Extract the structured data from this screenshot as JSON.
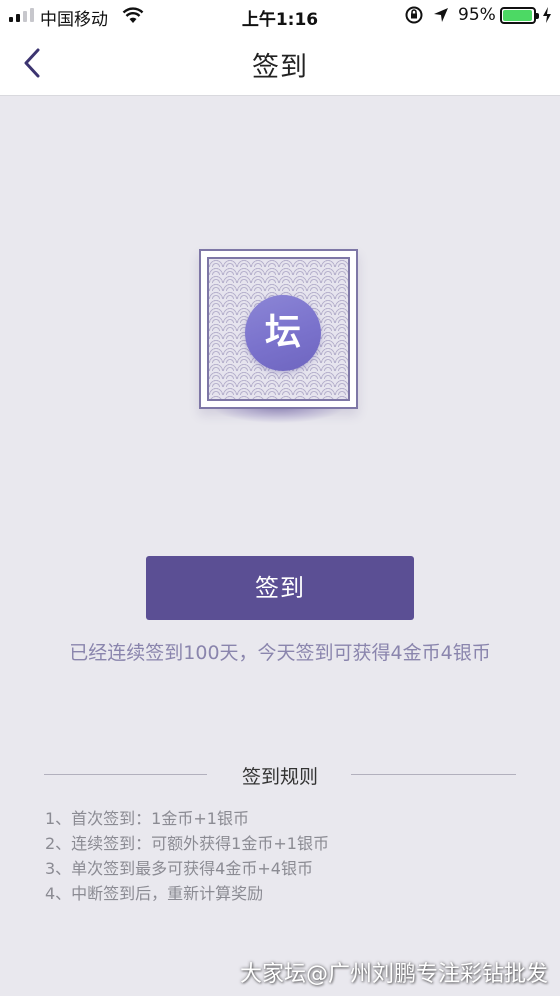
{
  "status_bar": {
    "carrier": "中国移动",
    "time": "上午1:16",
    "battery_pct": "95%",
    "battery_level": 0.95,
    "battery_color": "#4cd964"
  },
  "nav": {
    "title": "签到",
    "back_icon": "chevron-left-icon"
  },
  "badge": {
    "logo_text": "坛"
  },
  "sign_button": {
    "label": "签到",
    "color": "#5b4f94"
  },
  "status_text": "已经连续签到100天，今天签到可获得4金币4银币",
  "rules": {
    "title": "签到规则",
    "items": [
      "1、首次签到：1金币+1银币",
      "2、连续签到：可额外获得1金币+1银币",
      "3、单次签到最多可获得4金币+4银币",
      "4、中断签到后，重新计算奖励"
    ]
  },
  "watermark": "大家坛@广州刘鹏专注彩钻批发"
}
